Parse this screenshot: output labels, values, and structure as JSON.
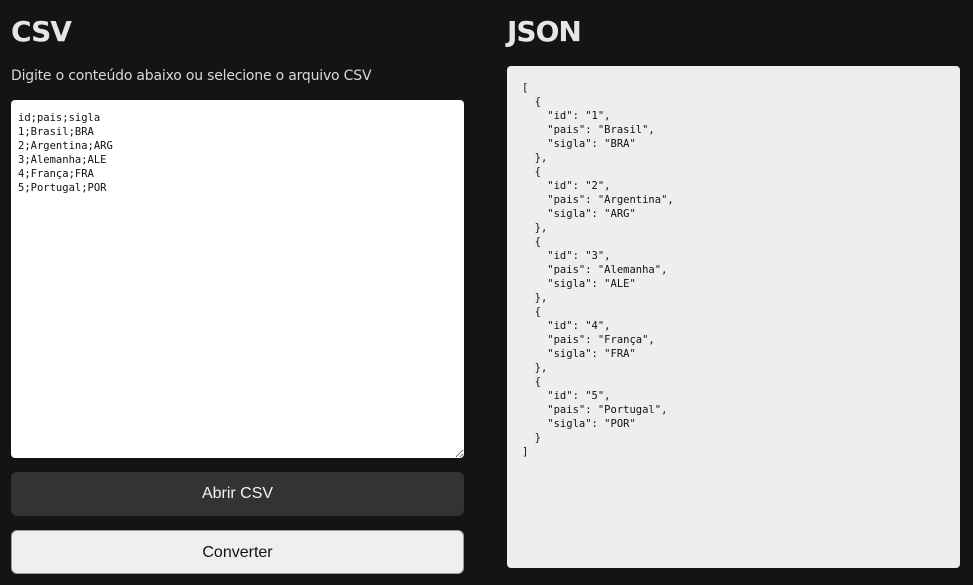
{
  "csv_panel": {
    "title": "CSV",
    "subtitle": "Digite o conteúdo abaixo ou selecione o arquivo CSV",
    "input_value": "id;pais;sigla\n1;Brasil;BRA\n2;Argentina;ARG\n3;Alemanha;ALE\n4;França;FRA\n5;Portugal;POR",
    "open_button_label": "Abrir CSV",
    "convert_button_label": "Converter"
  },
  "json_panel": {
    "title": "JSON",
    "output_text": "[\n  {\n    \"id\": \"1\",\n    \"pais\": \"Brasil\",\n    \"sigla\": \"BRA\"\n  },\n  {\n    \"id\": \"2\",\n    \"pais\": \"Argentina\",\n    \"sigla\": \"ARG\"\n  },\n  {\n    \"id\": \"3\",\n    \"pais\": \"Alemanha\",\n    \"sigla\": \"ALE\"\n  },\n  {\n    \"id\": \"4\",\n    \"pais\": \"França\",\n    \"sigla\": \"FRA\"\n  },\n  {\n    \"id\": \"5\",\n    \"pais\": \"Portugal\",\n    \"sigla\": \"POR\"\n  }\n]"
  },
  "colors": {
    "background": "#141414",
    "heading": "#e6e6e6",
    "open_button_bg": "#333333",
    "convert_button_bg": "#efefef",
    "output_bg": "#eeeeee"
  }
}
